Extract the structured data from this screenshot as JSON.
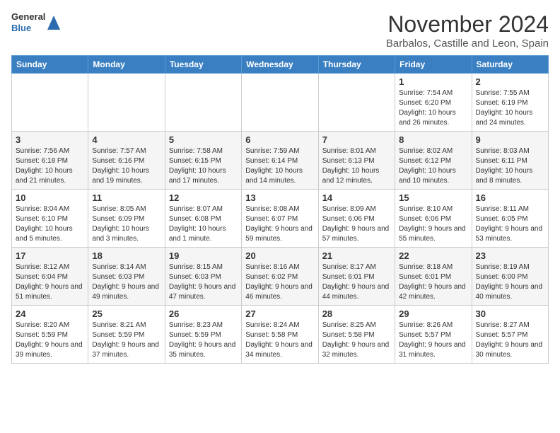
{
  "header": {
    "logo": {
      "line1": "General",
      "line2": "Blue"
    },
    "title": "November 2024",
    "location": "Barbalos, Castille and Leon, Spain"
  },
  "weekdays": [
    "Sunday",
    "Monday",
    "Tuesday",
    "Wednesday",
    "Thursday",
    "Friday",
    "Saturday"
  ],
  "weeks": [
    [
      {
        "day": "",
        "info": ""
      },
      {
        "day": "",
        "info": ""
      },
      {
        "day": "",
        "info": ""
      },
      {
        "day": "",
        "info": ""
      },
      {
        "day": "",
        "info": ""
      },
      {
        "day": "1",
        "info": "Sunrise: 7:54 AM\nSunset: 6:20 PM\nDaylight: 10 hours and 26 minutes."
      },
      {
        "day": "2",
        "info": "Sunrise: 7:55 AM\nSunset: 6:19 PM\nDaylight: 10 hours and 24 minutes."
      }
    ],
    [
      {
        "day": "3",
        "info": "Sunrise: 7:56 AM\nSunset: 6:18 PM\nDaylight: 10 hours and 21 minutes."
      },
      {
        "day": "4",
        "info": "Sunrise: 7:57 AM\nSunset: 6:16 PM\nDaylight: 10 hours and 19 minutes."
      },
      {
        "day": "5",
        "info": "Sunrise: 7:58 AM\nSunset: 6:15 PM\nDaylight: 10 hours and 17 minutes."
      },
      {
        "day": "6",
        "info": "Sunrise: 7:59 AM\nSunset: 6:14 PM\nDaylight: 10 hours and 14 minutes."
      },
      {
        "day": "7",
        "info": "Sunrise: 8:01 AM\nSunset: 6:13 PM\nDaylight: 10 hours and 12 minutes."
      },
      {
        "day": "8",
        "info": "Sunrise: 8:02 AM\nSunset: 6:12 PM\nDaylight: 10 hours and 10 minutes."
      },
      {
        "day": "9",
        "info": "Sunrise: 8:03 AM\nSunset: 6:11 PM\nDaylight: 10 hours and 8 minutes."
      }
    ],
    [
      {
        "day": "10",
        "info": "Sunrise: 8:04 AM\nSunset: 6:10 PM\nDaylight: 10 hours and 5 minutes."
      },
      {
        "day": "11",
        "info": "Sunrise: 8:05 AM\nSunset: 6:09 PM\nDaylight: 10 hours and 3 minutes."
      },
      {
        "day": "12",
        "info": "Sunrise: 8:07 AM\nSunset: 6:08 PM\nDaylight: 10 hours and 1 minute."
      },
      {
        "day": "13",
        "info": "Sunrise: 8:08 AM\nSunset: 6:07 PM\nDaylight: 9 hours and 59 minutes."
      },
      {
        "day": "14",
        "info": "Sunrise: 8:09 AM\nSunset: 6:06 PM\nDaylight: 9 hours and 57 minutes."
      },
      {
        "day": "15",
        "info": "Sunrise: 8:10 AM\nSunset: 6:06 PM\nDaylight: 9 hours and 55 minutes."
      },
      {
        "day": "16",
        "info": "Sunrise: 8:11 AM\nSunset: 6:05 PM\nDaylight: 9 hours and 53 minutes."
      }
    ],
    [
      {
        "day": "17",
        "info": "Sunrise: 8:12 AM\nSunset: 6:04 PM\nDaylight: 9 hours and 51 minutes."
      },
      {
        "day": "18",
        "info": "Sunrise: 8:14 AM\nSunset: 6:03 PM\nDaylight: 9 hours and 49 minutes."
      },
      {
        "day": "19",
        "info": "Sunrise: 8:15 AM\nSunset: 6:03 PM\nDaylight: 9 hours and 47 minutes."
      },
      {
        "day": "20",
        "info": "Sunrise: 8:16 AM\nSunset: 6:02 PM\nDaylight: 9 hours and 46 minutes."
      },
      {
        "day": "21",
        "info": "Sunrise: 8:17 AM\nSunset: 6:01 PM\nDaylight: 9 hours and 44 minutes."
      },
      {
        "day": "22",
        "info": "Sunrise: 8:18 AM\nSunset: 6:01 PM\nDaylight: 9 hours and 42 minutes."
      },
      {
        "day": "23",
        "info": "Sunrise: 8:19 AM\nSunset: 6:00 PM\nDaylight: 9 hours and 40 minutes."
      }
    ],
    [
      {
        "day": "24",
        "info": "Sunrise: 8:20 AM\nSunset: 5:59 PM\nDaylight: 9 hours and 39 minutes."
      },
      {
        "day": "25",
        "info": "Sunrise: 8:21 AM\nSunset: 5:59 PM\nDaylight: 9 hours and 37 minutes."
      },
      {
        "day": "26",
        "info": "Sunrise: 8:23 AM\nSunset: 5:59 PM\nDaylight: 9 hours and 35 minutes."
      },
      {
        "day": "27",
        "info": "Sunrise: 8:24 AM\nSunset: 5:58 PM\nDaylight: 9 hours and 34 minutes."
      },
      {
        "day": "28",
        "info": "Sunrise: 8:25 AM\nSunset: 5:58 PM\nDaylight: 9 hours and 32 minutes."
      },
      {
        "day": "29",
        "info": "Sunrise: 8:26 AM\nSunset: 5:57 PM\nDaylight: 9 hours and 31 minutes."
      },
      {
        "day": "30",
        "info": "Sunrise: 8:27 AM\nSunset: 5:57 PM\nDaylight: 9 hours and 30 minutes."
      }
    ]
  ]
}
